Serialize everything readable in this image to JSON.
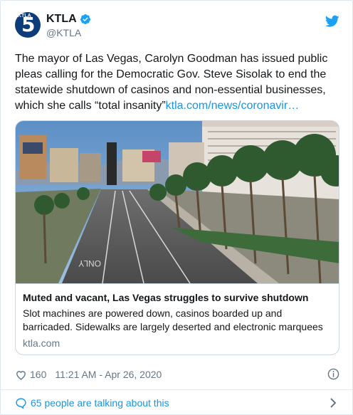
{
  "account": {
    "display_name": "KTLA",
    "handle": "@KTLA",
    "avatar_text": "5",
    "avatar_small_text": "KTLA"
  },
  "tweet": {
    "text": "The mayor of Las Vegas, Carolyn Goodman has issued public pleas calling for the Democratic Gov. Steve Sisolak to end the statewide shutdown of casinos and non-essential businesses, which she calls “total insanity”",
    "link_text": "ktla.com/news/coronavir…"
  },
  "card": {
    "title": "Muted and vacant, Las Vegas struggles to survive shutdown",
    "description": "Slot machines are powered down, casinos boarded up and barricaded. Sidewalks are largely deserted and electronic marquees",
    "domain": "ktla.com",
    "road_marking": "ONLY"
  },
  "meta": {
    "likes": "160",
    "timestamp": "11:21 AM - Apr 26, 2020"
  },
  "footer": {
    "conversation_text": "65 people are talking about this"
  },
  "colors": {
    "link": "#1b95e0",
    "secondary_text": "#657786",
    "border": "#e1e8ed"
  },
  "icons": {
    "verified": "verified-badge-icon",
    "brand": "twitter-bird-icon",
    "like": "heart-icon",
    "info": "info-icon",
    "conversation": "comment-icon",
    "chevron": "chevron-right-icon"
  }
}
